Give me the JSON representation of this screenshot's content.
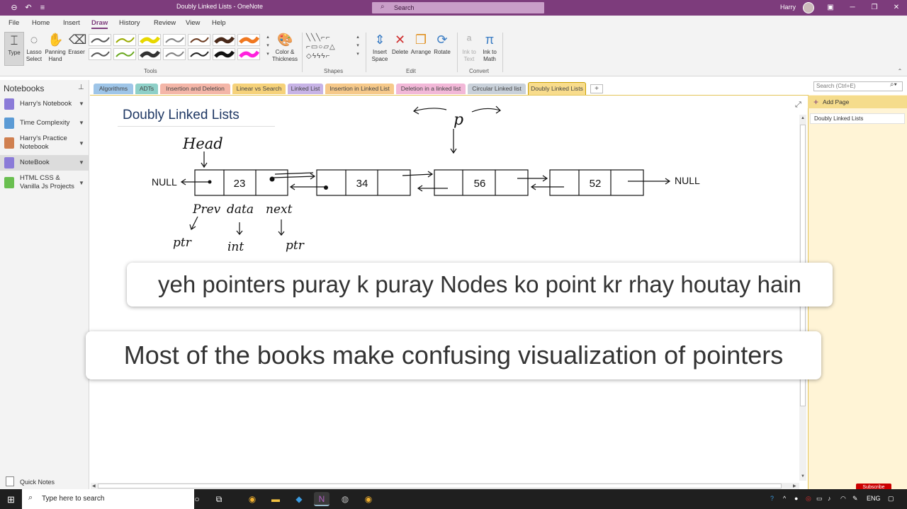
{
  "window": {
    "title": "Doubly Linked Lists - OneNote",
    "search_placeholder": "Search",
    "user_name": "Harry"
  },
  "menus": [
    "File",
    "Home",
    "Insert",
    "Draw",
    "History",
    "Review",
    "View",
    "Help"
  ],
  "active_menu": "Draw",
  "ribbon": {
    "type": "Type",
    "lasso_select": "Lasso Select",
    "panning_hand": "Panning Hand",
    "eraser": "Eraser",
    "color_thickness": "Color & Thickness",
    "insert_space": "Insert Space",
    "delete": "Delete",
    "arrange": "Arrange",
    "rotate": "Rotate",
    "ink_to_text": "Ink to Text",
    "ink_to_math": "Ink to Math",
    "groups": {
      "tools": "Tools",
      "shapes": "Shapes",
      "edit": "Edit",
      "convert": "Convert"
    },
    "pen_colors": [
      "#555555",
      "#9aaa00",
      "#e8d800",
      "#808080",
      "#6b3a1f",
      "#4a2a1a",
      "#f07820",
      "#555555",
      "#6aa820",
      "#333333",
      "#808080",
      "#222222",
      "#111111",
      "#ff22dd"
    ]
  },
  "notebooks": {
    "header": "Notebooks",
    "items": [
      {
        "label": "Harry's Notebook",
        "color": "#8b7bd8"
      },
      {
        "label": "Time Complexity",
        "color": "#5b9bd5"
      },
      {
        "label": "Harry's Practice Notebook",
        "color": "#d08050"
      },
      {
        "label": "NoteBook",
        "color": "#8b7bd8"
      },
      {
        "label": "HTML CSS & Vanilla Js Projects",
        "color": "#6abf50"
      }
    ],
    "quick_notes": "Quick Notes"
  },
  "tabs": [
    {
      "label": "Algorithms",
      "color": "#9ec5e8"
    },
    {
      "label": "ADTs",
      "color": "#8ed0c8"
    },
    {
      "label": "Insertion and Deletion",
      "color": "#f4b6a8"
    },
    {
      "label": "Linear vs Search",
      "color": "#f6d27a"
    },
    {
      "label": "Linked List",
      "color": "#c7b3e6"
    },
    {
      "label": "Insertion in Linked List",
      "color": "#f6c98a"
    },
    {
      "label": "Deletion in a linked list",
      "color": "#f2b8d8"
    },
    {
      "label": "Circular Linked list",
      "color": "#c9d1da"
    },
    {
      "label": "Doubly Linked Lists",
      "color": "#f8dc8c"
    }
  ],
  "page": {
    "title": "Doubly Linked Lists",
    "search_placeholder": "Search (Ctrl+E)",
    "add_page": "Add Page",
    "pages": [
      "Doubly Linked Lists"
    ]
  },
  "diagram": {
    "null_left": "NULL",
    "null_right": "NULL",
    "values": [
      "23",
      "34",
      "56",
      "52"
    ],
    "head_label": "Head",
    "pointer_label": "p",
    "field_labels": [
      "Prev",
      "data",
      "next"
    ],
    "type_labels": [
      "ptr",
      "int",
      "ptr"
    ]
  },
  "subtitles": {
    "line1": "yeh pointers puray k puray Nodes ko point kr rhay houtay hain",
    "line2": "Most of the books make confusing visualization of pointers"
  },
  "taskbar": {
    "search": "Type here to search",
    "language": "ENG",
    "subscribe": "Subscribe"
  }
}
